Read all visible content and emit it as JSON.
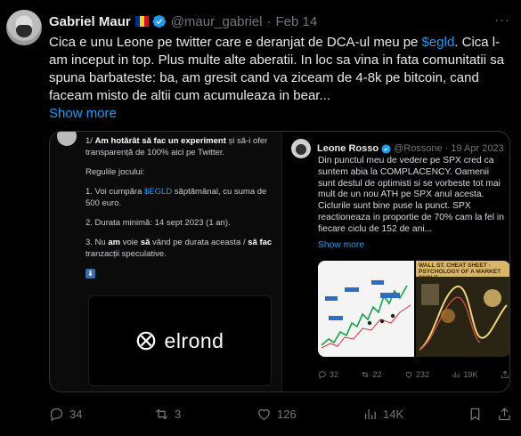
{
  "tweet": {
    "author_name": "Gabriel Maur",
    "author_handle": "@maur_gabriel",
    "separator": "·",
    "date": "Feb 14",
    "more_label": "···",
    "text_parts": {
      "before_link": "Cica e unu Leone pe twitter care e deranjat de DCA-ul meu pe ",
      "link": "$egld",
      "after_link": ". Cica l-am inceput in top. Plus multe alte aberatii. In loc sa vina in fata comunitatii sa spuna barbateste: ba, am gresit cand va ziceam de 4-8k pe bitcoin, cand faceam misto de altii cum acumuleaza in bear..."
    },
    "show_more": "Show more",
    "flag_colors": [
      "#002b7f",
      "#fcd116",
      "#ce1126"
    ],
    "accent_color": "#1d9bf0"
  },
  "left_image": {
    "line1_prefix": "1/ ",
    "line1_bold": "Am hotărât să fac un experiment",
    "line1_rest": " și să-i ofer transparență de 100% aici pe Twitter.",
    "rules_title": "Regulile jocului:",
    "rule1_before": "1. Voi cumpăra ",
    "rule1_link": "$EGLD",
    "rule1_after": " săptămânal, cu suma de 500 euro.",
    "rule2": "2. Durata minimă: 14 sept 2023 (1 an).",
    "rule3_a": "3. Nu ",
    "rule3_b": "am",
    "rule3_c": " voie ",
    "rule3_d": "să",
    "rule3_e": " vând pe durata aceasta / ",
    "rule3_f": "să fac",
    "rule3_g": " tranzacții speculative.",
    "arrow_glyph": "⬇",
    "brand_word": "elrond"
  },
  "quoted": {
    "name": "Leone Rosso",
    "handle": "@Rossone",
    "separator": "·",
    "date": "19 Apr 2023",
    "text": "Din punctul meu de vedere pe SPX cred ca suntem abia la COMPLACENCY. Oamenii sunt destul de optimisti si se vorbeste tot mai mult de un nou ATH pe SPX anul acesta. Ciclurile sunt bine puse la punct. SPX reactioneaza in proportie de 70% cam la fel in fiecare ciclu de 152 de ani...",
    "show_more": "Show more",
    "chart_label": "WALL ST. CHEAT SHEET · PSYCHOLOGY OF A MARKET CYCLE",
    "replies": "32",
    "retweets": "22",
    "likes": "232",
    "views": "19K"
  },
  "actions": {
    "replies": "34",
    "retweets": "3",
    "likes": "126",
    "views": "14K"
  }
}
